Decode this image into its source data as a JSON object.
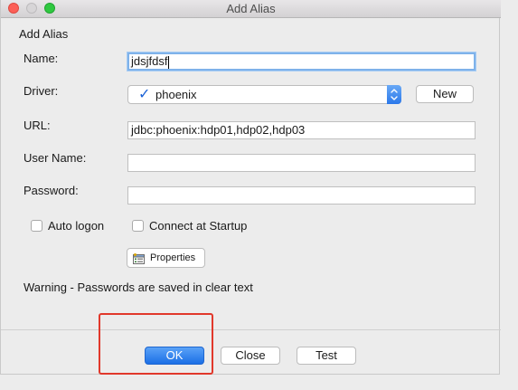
{
  "window": {
    "title": "Add Alias"
  },
  "dialog": {
    "heading": "Add Alias"
  },
  "form": {
    "name": {
      "label": "Name:",
      "value": "jdsjfdsf"
    },
    "driver": {
      "label": "Driver:",
      "selected": "phoenix",
      "new_button": "New"
    },
    "url": {
      "label": "URL:",
      "value": "jdbc:phoenix:hdp01,hdp02,hdp03"
    },
    "user_name": {
      "label": "User Name:",
      "value": ""
    },
    "password": {
      "label": "Password:",
      "value": ""
    },
    "auto_logon": {
      "label": "Auto logon",
      "checked": false
    },
    "connect_at_startup": {
      "label": "Connect at Startup",
      "checked": false
    },
    "properties_button": "Properties",
    "warning": "Warning - Passwords are saved in clear text"
  },
  "footer": {
    "ok": "OK",
    "close": "Close",
    "test": "Test"
  },
  "icons": {
    "driver_check": "checkmark-icon",
    "driver_stepper": "chevron-updown-icon",
    "properties": "properties-sheet-icon"
  },
  "colors": {
    "accent": "#1b6fe6",
    "annotation": "#e1382b",
    "check": "#1a62d6"
  }
}
